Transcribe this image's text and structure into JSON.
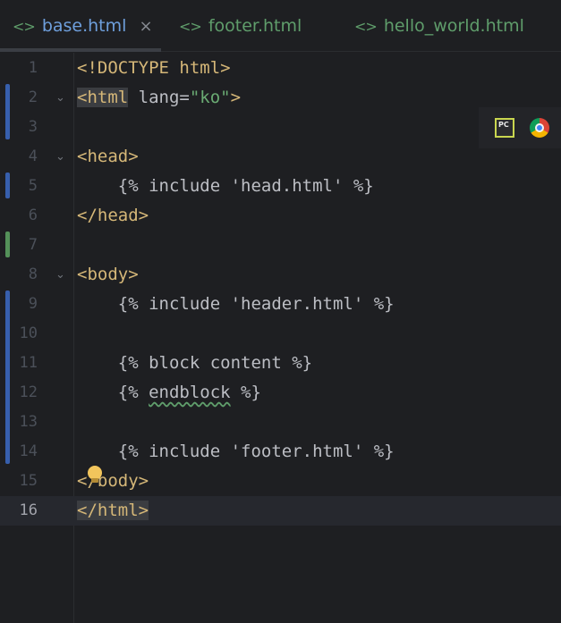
{
  "tabs": [
    {
      "label": "base.html",
      "icon": "html-file-icon",
      "active": true,
      "close": "×"
    },
    {
      "label": "footer.html",
      "icon": "html-file-icon",
      "active": false
    },
    {
      "label": "hello_world.html",
      "icon": "html-file-icon",
      "active": false
    }
  ],
  "tab_icon_glyph": "<>",
  "editor": {
    "current_line": 16,
    "lines": [
      {
        "n": "1"
      },
      {
        "n": "2"
      },
      {
        "n": "3"
      },
      {
        "n": "4"
      },
      {
        "n": "5"
      },
      {
        "n": "6"
      },
      {
        "n": "7"
      },
      {
        "n": "8"
      },
      {
        "n": "9"
      },
      {
        "n": "10"
      },
      {
        "n": "11"
      },
      {
        "n": "12"
      },
      {
        "n": "13"
      },
      {
        "n": "14"
      },
      {
        "n": "15"
      },
      {
        "n": "16"
      }
    ],
    "code": {
      "l1": "<!DOCTYPE html>",
      "l2_tag": "<html",
      "l2_attr": " lang=",
      "l2_str": "\"ko\"",
      "l2_end": ">",
      "l4": "<head>",
      "l5": "    {% include 'head.html' %}",
      "l6": "</head>",
      "l8": "<body>",
      "l9": "    {% include 'header.html' %}",
      "l11": "    {% block content %}",
      "l12_a": "    {% ",
      "l12_b": "endblock",
      "l12_c": " %}",
      "l14": "    {% include 'footer.html' %}",
      "l15": "</body>",
      "l16": "</html>"
    }
  },
  "browser_icons": {
    "pycharm_label": "PC"
  },
  "colors": {
    "background": "#1e1f22",
    "tag": "#d5b778",
    "string": "#6aab73",
    "active_tab": "#6e9fdc",
    "modified_marker": "#375fad",
    "added_marker": "#549159"
  }
}
